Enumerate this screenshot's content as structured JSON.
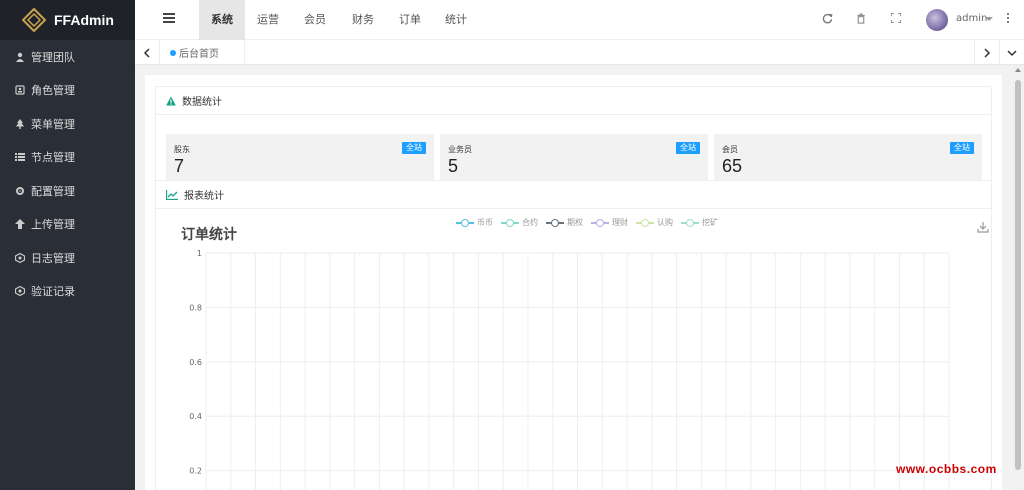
{
  "app": {
    "name": "FFAdmin"
  },
  "sidebar": {
    "items": [
      {
        "label": "管理团队",
        "icon": "user-icon"
      },
      {
        "label": "角色管理",
        "icon": "id-card-icon"
      },
      {
        "label": "菜单管理",
        "icon": "tree-icon"
      },
      {
        "label": "节点管理",
        "icon": "list-icon"
      },
      {
        "label": "配置管理",
        "icon": "gear-icon"
      },
      {
        "label": "上传管理",
        "icon": "upload-icon"
      },
      {
        "label": "日志管理",
        "icon": "log-icon"
      },
      {
        "label": "验证记录",
        "icon": "verify-icon"
      }
    ]
  },
  "header": {
    "tabs": [
      "系统",
      "运营",
      "会员",
      "财务",
      "订单",
      "统计"
    ],
    "active_tab": "系统",
    "icons": [
      "refresh-icon",
      "trash-icon",
      "fullscreen-icon"
    ],
    "user": {
      "name": "admin"
    }
  },
  "tabbar": {
    "home_label": "后台首页"
  },
  "stats_panel": {
    "title": "数据统计",
    "cards": [
      {
        "label": "股东",
        "value": "7",
        "badge": "全站"
      },
      {
        "label": "业务员",
        "value": "5",
        "badge": "全站"
      },
      {
        "label": "会员",
        "value": "65",
        "badge": "全站"
      }
    ]
  },
  "report_panel": {
    "title": "报表统计"
  },
  "chart_data": {
    "type": "line",
    "title": "订单统计",
    "series": [
      {
        "name": "币币",
        "color": "#5bc0de",
        "values": []
      },
      {
        "name": "合约",
        "color": "#7fd8c8",
        "values": []
      },
      {
        "name": "期权",
        "color": "#6b7280",
        "values": []
      },
      {
        "name": "理财",
        "color": "#b5b3e6",
        "values": []
      },
      {
        "name": "认购",
        "color": "#c8e6a8",
        "values": []
      },
      {
        "name": "挖矿",
        "color": "#9ee0c4",
        "values": []
      }
    ],
    "yticks": [
      "1",
      "0.8",
      "0.6",
      "0.4",
      "0.2"
    ],
    "ylim": [
      0,
      1
    ],
    "grid": true,
    "legend_position": "top-center"
  },
  "watermark": "www.ocbbs.com",
  "colors": {
    "sidebar_bg": "#2a2e36",
    "accent": "#1e9fff"
  }
}
